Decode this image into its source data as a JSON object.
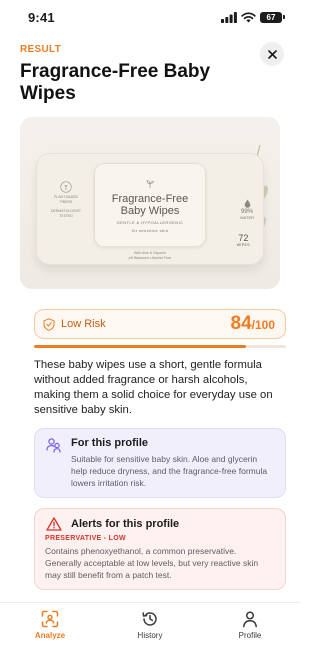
{
  "status_bar": {
    "time": "9:41",
    "battery": "67"
  },
  "header": {
    "label": "RESULT",
    "title": "Fragrance-Free Baby Wipes"
  },
  "product_image": {
    "brand_line_1": "Fragrance-Free",
    "brand_line_2": "Baby Wipes",
    "tagline": "GENTLE & HYPOALLERGENIC",
    "for_skin": "for sensitive skin",
    "left_badge_1": "PLANT-BASED",
    "left_badge_2": "FIBERS",
    "left_badge_3": "DERMATOLOGIST",
    "left_badge_4": "TESTED",
    "water_pct": "99%",
    "water_label": "WATER",
    "count": "72",
    "count_label": "WIPES",
    "bottom_1": "With Aloe & Glycerin",
    "bottom_2": "pH Balanced • Alcohol Free"
  },
  "score": {
    "risk_label": "Low Risk",
    "value": "84",
    "max": "/100",
    "fraction": 0.84
  },
  "description": "These baby wipes use a short, gentle formula without added fragrance or harsh alcohols, making them a solid choice for everyday use on sensitive baby skin.",
  "profile_card": {
    "title": "For this profile",
    "text": "Suitable for sensitive baby skin. Aloe and glycerin help reduce dryness, and the fragrance-free formula lowers irritation risk."
  },
  "alerts_card": {
    "title": "Alerts for this profile",
    "tag": "PRESERVATIVE - LOW",
    "text": "Contains phenoxyethanol, a common preservative. Generally acceptable at low levels, but very reactive skin may still benefit from a patch test."
  },
  "tabs": [
    {
      "label": "Analyze",
      "icon": "scan-icon",
      "active": true
    },
    {
      "label": "History",
      "icon": "history-icon",
      "active": false
    },
    {
      "label": "Profile",
      "icon": "person-icon",
      "active": false
    }
  ],
  "colors": {
    "accent": "#f07c22",
    "profile_bg": "#f2effd",
    "alert_bg": "#fff1ef",
    "alert_red": "#d6332b"
  }
}
